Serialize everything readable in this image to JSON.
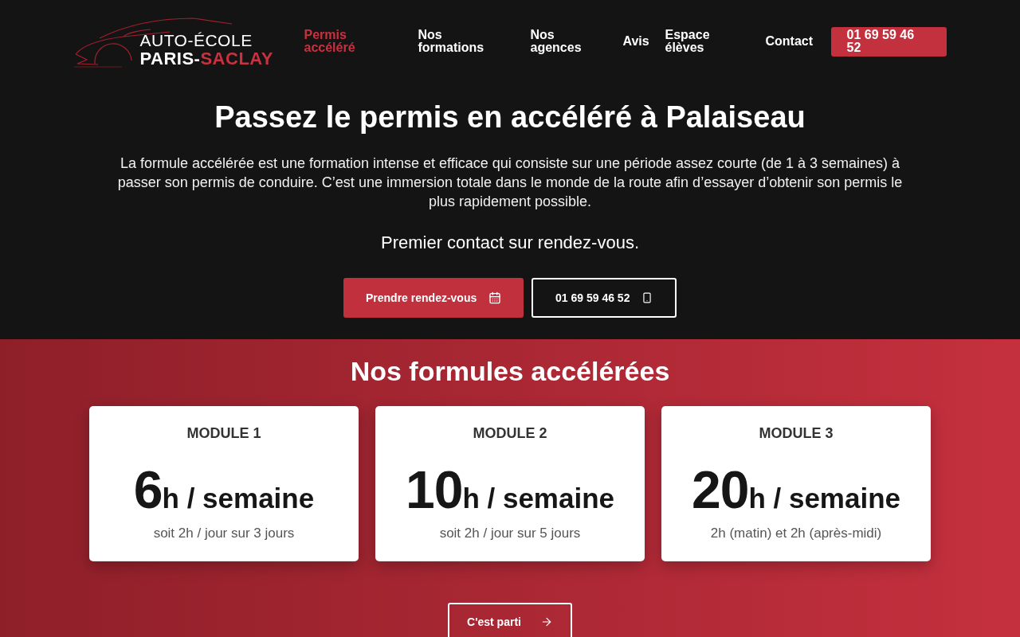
{
  "header": {
    "logo": {
      "top_line": "AUTO-ÉCOLE",
      "bottom_line": "PARIS-",
      "bottom_line_accent": "SACLAY"
    },
    "nav": [
      {
        "label": "Permis accéléré",
        "selected": true
      },
      {
        "label": "Nos formations",
        "selected": false
      },
      {
        "label": "Nos agences",
        "selected": false
      },
      {
        "label": "Avis",
        "selected": false
      },
      {
        "label": "Espace élèves",
        "selected": false
      },
      {
        "label": "Contact",
        "selected": false
      }
    ],
    "phone_button": "01 69 59 46 52"
  },
  "hero": {
    "title": "Passez le permis en accéléré à Palaiseau",
    "description": "La formule accélérée est une formation intense et efficace qui consiste sur une période assez courte (de 1 à 3 semaines) à passer son permis de conduire. C’est une immersion totale dans le monde de la route afin d’essayer d’obtenir son permis le plus rapidement possible.",
    "subtitle": "Premier contact sur rendez-vous.",
    "buttons": [
      {
        "label": "Prendre rendez-vous",
        "kind": "appointment"
      },
      {
        "label": "01 69 59 46 52",
        "kind": "phone"
      }
    ]
  },
  "formulas": {
    "title": "Nos formules accélérées",
    "cards": [
      {
        "name": "MODULE 1",
        "hours": "6",
        "unit": "h / semaine",
        "detail": "soit 2h / jour sur 3 jours"
      },
      {
        "name": "MODULE 2",
        "hours": "10",
        "unit": "h / semaine",
        "detail": "soit 2h / jour sur 5 jours"
      },
      {
        "name": "MODULE 3",
        "hours": "20",
        "unit": "h / semaine",
        "detail": "2h (matin) et 2h (après-midi)"
      }
    ],
    "cta": "C'est parti"
  }
}
